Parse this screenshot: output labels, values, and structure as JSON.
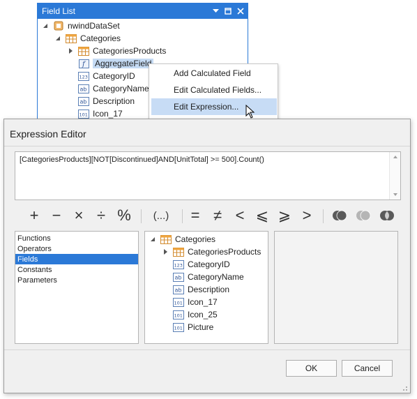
{
  "field_list": {
    "title": "Field List",
    "tree": [
      {
        "label": "nwindDataSet",
        "icon": "database-icon"
      },
      {
        "label": "Categories",
        "icon": "table-icon"
      },
      {
        "label": "CategoriesProducts",
        "icon": "table-icon"
      },
      {
        "label": "AggregateField",
        "icon": "calculated-field-icon"
      },
      {
        "label": "CategoryID",
        "icon": "numeric-field-icon"
      },
      {
        "label": "CategoryName",
        "icon": "text-field-icon"
      },
      {
        "label": "Description",
        "icon": "text-field-icon"
      },
      {
        "label": "Icon_17",
        "icon": "binary-field-icon"
      }
    ]
  },
  "context_menu": {
    "items": [
      {
        "label": "Add Calculated Field"
      },
      {
        "label": "Edit Calculated Fields..."
      },
      {
        "label": "Edit Expression..."
      }
    ]
  },
  "expression_editor": {
    "title": "Expression Editor",
    "expression": "[CategoriesProducts][NOT[Discontinued]AND[UnitTotal] >= 500].Count()",
    "operators": [
      "+",
      "−",
      "×",
      "÷",
      "%",
      "(...)",
      "=",
      "≠",
      "<",
      "⩽",
      "⩾",
      ">"
    ],
    "categories": [
      "Functions",
      "Operators",
      "Fields",
      "Constants",
      "Parameters"
    ],
    "selected_category": "Fields",
    "fields_tree": [
      {
        "label": "Categories",
        "icon": "table-icon"
      },
      {
        "label": "CategoriesProducts",
        "icon": "table-icon"
      },
      {
        "label": "CategoryID",
        "icon": "numeric-field-icon"
      },
      {
        "label": "CategoryName",
        "icon": "text-field-icon"
      },
      {
        "label": "Description",
        "icon": "text-field-icon"
      },
      {
        "label": "Icon_17",
        "icon": "binary-field-icon"
      },
      {
        "label": "Icon_25",
        "icon": "binary-field-icon"
      },
      {
        "label": "Picture",
        "icon": "binary-field-icon"
      }
    ],
    "ok_label": "OK",
    "cancel_label": "Cancel"
  },
  "icon_labels": {
    "numeric": "123",
    "text": "ab",
    "binary": "101",
    "calc": "f"
  },
  "colors": {
    "accent": "#2b79d7",
    "selection": "#c5dbf4",
    "menu_highlight": "#c7dcf5"
  }
}
